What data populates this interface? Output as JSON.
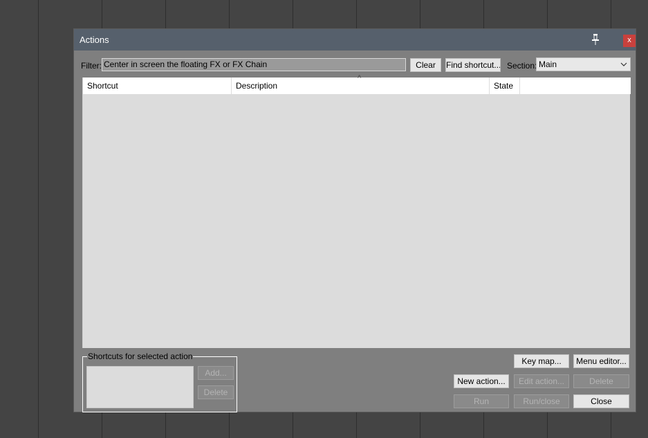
{
  "window": {
    "title": "Actions"
  },
  "filter": {
    "label": "Filter:",
    "value": "Center in screen the floating FX or FX Chain"
  },
  "buttons": {
    "clear": "Clear",
    "find_shortcut": "Find shortcut...",
    "add": "Add...",
    "delete_shortcut": "Delete",
    "key_map": "Key map...",
    "menu_editor": "Menu editor...",
    "new_action": "New action...",
    "edit_action": "Edit action...",
    "delete_action": "Delete",
    "run": "Run",
    "run_close": "Run/close",
    "close": "Close"
  },
  "section": {
    "label": "Section:",
    "value": "Main"
  },
  "table": {
    "columns": [
      "Shortcut",
      "Description",
      "State",
      ""
    ],
    "sort_indicator": "^",
    "rows": []
  },
  "shortcuts_group": {
    "label": "Shortcuts for selected action"
  },
  "icons": {
    "pin": "pin-icon",
    "close": "close-icon",
    "dropdown": "chevron-down-icon"
  },
  "colors": {
    "titlebar": "#56606c",
    "close_button": "#c9413d",
    "dialog_bg": "#7f7f7f",
    "list_bg": "#dcdcdc"
  }
}
